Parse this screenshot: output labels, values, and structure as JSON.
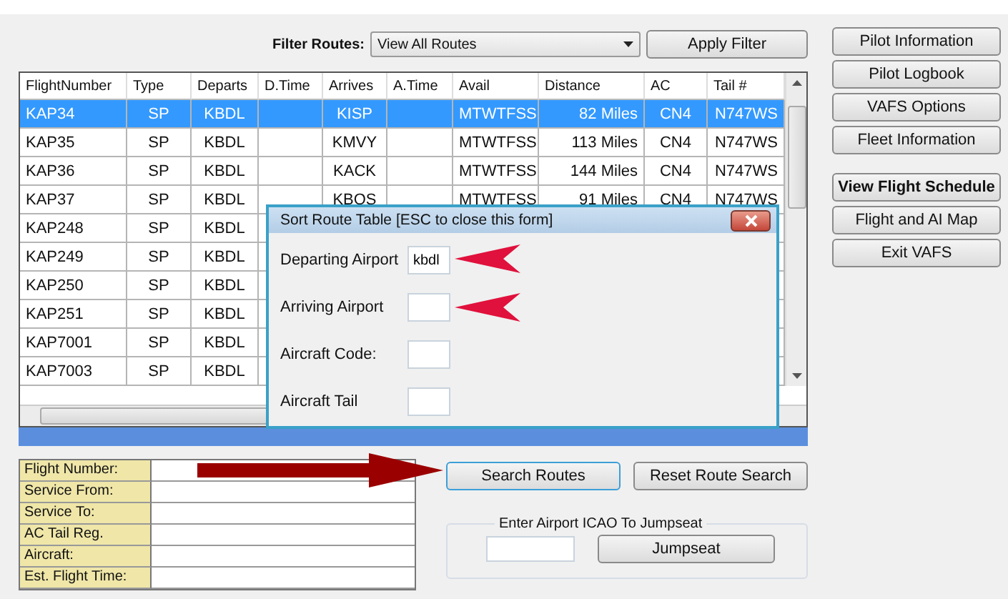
{
  "filter": {
    "label": "Filter Routes:",
    "value": "View All Routes"
  },
  "apply_button": "Apply Filter",
  "table": {
    "columns": [
      "FlightNumber",
      "Type",
      "Departs",
      "D.Time",
      "Arrives",
      "A.Time",
      "Avail",
      "Distance",
      "AC",
      "Tail #"
    ],
    "rows": [
      {
        "selected": true,
        "cells": [
          "KAP34",
          "SP",
          "KBDL",
          "",
          "KISP",
          "",
          "MTWTFSS",
          "82 Miles",
          "CN4",
          "N747WS"
        ]
      },
      {
        "selected": false,
        "cells": [
          "KAP35",
          "SP",
          "KBDL",
          "",
          "KMVY",
          "",
          "MTWTFSS",
          "113 Miles",
          "CN4",
          "N747WS"
        ]
      },
      {
        "selected": false,
        "cells": [
          "KAP36",
          "SP",
          "KBDL",
          "",
          "KACK",
          "",
          "MTWTFSS",
          "144 Miles",
          "CN4",
          "N747WS"
        ]
      },
      {
        "selected": false,
        "cells": [
          "KAP37",
          "SP",
          "KBDL",
          "",
          "KBOS",
          "",
          "MTWTFSS",
          "91 Miles",
          "CN4",
          "N747WS"
        ]
      },
      {
        "selected": false,
        "cells": [
          "KAP248",
          "SP",
          "KBDL"
        ]
      },
      {
        "selected": false,
        "cells": [
          "KAP249",
          "SP",
          "KBDL"
        ]
      },
      {
        "selected": false,
        "cells": [
          "KAP250",
          "SP",
          "KBDL"
        ]
      },
      {
        "selected": false,
        "cells": [
          "KAP251",
          "SP",
          "KBDL"
        ]
      },
      {
        "selected": false,
        "cells": [
          "KAP7001",
          "SP",
          "KBDL"
        ]
      },
      {
        "selected": false,
        "cells": [
          "KAP7003",
          "SP",
          "KBDL"
        ]
      }
    ]
  },
  "side_buttons": [
    {
      "label": "Pilot Information",
      "kind": "normal"
    },
    {
      "label": "Pilot Logbook",
      "kind": "normal"
    },
    {
      "label": "VAFS Options",
      "kind": "normal"
    },
    {
      "label": "Fleet Information",
      "kind": "normal"
    },
    {
      "label": "View Flight Schedule",
      "kind": "primary"
    },
    {
      "label": "Flight and AI Map",
      "kind": "normal"
    },
    {
      "label": "Exit VAFS",
      "kind": "normal"
    }
  ],
  "dialog": {
    "title": "Sort Route Table [ESC to close this form]",
    "fields": [
      {
        "label": "Departing Airport",
        "value": "kbdl"
      },
      {
        "label": "Arriving Airport"
      },
      {
        "label": "Aircraft Code:"
      },
      {
        "label": "Aircraft Tail"
      }
    ]
  },
  "details": [
    "Flight Number:",
    "Service From:",
    "Service To:",
    "AC Tail Reg.",
    "Aircraft:",
    "Est. Flight Time:"
  ],
  "search_button": "Search Routes",
  "reset_button": "Reset Route Search",
  "jumpseat": {
    "legend": "Enter Airport ICAO To Jumpseat",
    "button": "Jumpseat"
  }
}
